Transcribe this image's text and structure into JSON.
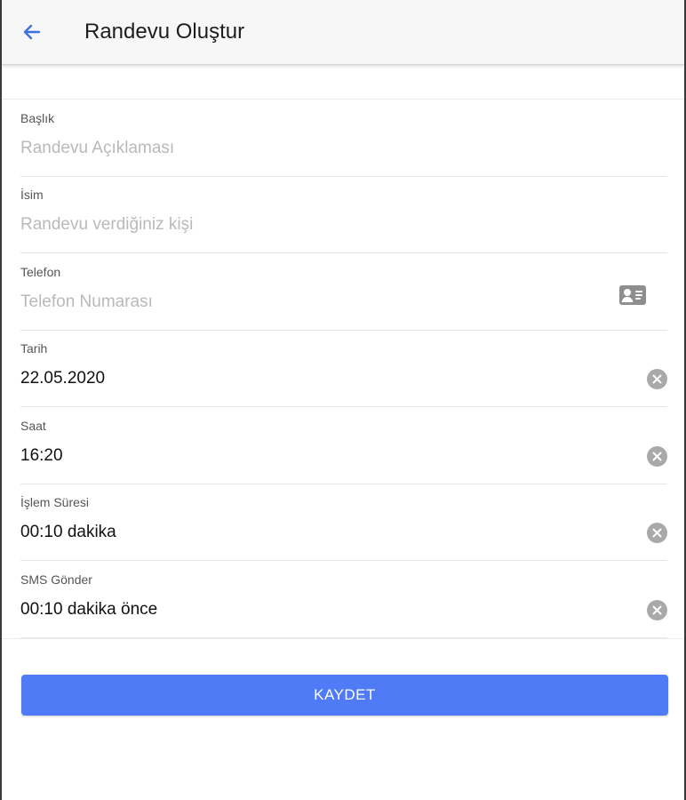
{
  "header": {
    "title": "Randevu Oluştur",
    "back_icon": "arrow-left-icon",
    "accent_color": "#3f6fe0"
  },
  "form": {
    "fields": [
      {
        "label": "Başlık",
        "value": "",
        "placeholder": "Randevu Açıklaması"
      },
      {
        "label": "İsim",
        "value": "",
        "placeholder": "Randevu verdiğiniz kişi"
      },
      {
        "label": "Telefon",
        "value": "",
        "placeholder": "Telefon Numarası",
        "icon": "contact-card-icon"
      },
      {
        "label": "Tarih",
        "value": "22.05.2020",
        "icon": "clear-icon"
      },
      {
        "label": "Saat",
        "value": "16:20",
        "icon": "clear-icon"
      },
      {
        "label": "İşlem Süresi",
        "value": "00:10 dakika",
        "icon": "clear-icon"
      },
      {
        "label": "SMS Gönder",
        "value": "00:10 dakika önce",
        "icon": "clear-icon"
      }
    ]
  },
  "actions": {
    "save_label": "KAYDET",
    "save_color": "#4f7cf6"
  }
}
